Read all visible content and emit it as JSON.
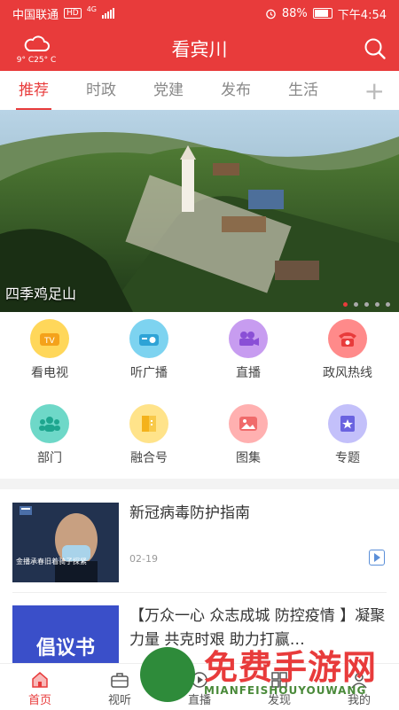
{
  "status": {
    "carrier": "中国联通",
    "hd": "HD",
    "net": "4G",
    "battery": "88%",
    "time": "下午4:54"
  },
  "header": {
    "title": "看宾川",
    "weather": "9° C25° C"
  },
  "tabs": [
    "推荐",
    "时政",
    "党建",
    "发布",
    "生活"
  ],
  "banner": {
    "caption": "四季鸡足山"
  },
  "grid": [
    {
      "label": "看电视",
      "color": "#ffd75a",
      "icon": "tv-icon"
    },
    {
      "label": "听广播",
      "color": "#7dd3f0",
      "icon": "radio-icon"
    },
    {
      "label": "直播",
      "color": "#c79cf0",
      "icon": "camera-icon"
    },
    {
      "label": "政风热线",
      "color": "#ff8a8a",
      "icon": "phone-icon"
    },
    {
      "label": "部门",
      "color": "#6ed8c8",
      "icon": "people-icon"
    },
    {
      "label": "融合号",
      "color": "#ffd75a",
      "icon": "book-icon"
    },
    {
      "label": "图集",
      "color": "#ff9a9a",
      "icon": "picture-icon"
    },
    {
      "label": "专题",
      "color": "#a9a4f5",
      "icon": "topic-icon"
    }
  ],
  "news": [
    {
      "title": "新冠病毒防护指南",
      "date": "02-19",
      "thumb_caption": "金播承春旧着骑子探紧"
    },
    {
      "title": "【万众一心 众志成城 防控疫情 】凝聚力量 共克时艰 助力打赢…",
      "thumb_text": "倡议书"
    }
  ],
  "nav": [
    "首页",
    "视听",
    "直播",
    "发现",
    "我的"
  ],
  "watermark": {
    "text": "免费手游网",
    "sub": "MIANFEISHOUYOUWANG"
  }
}
